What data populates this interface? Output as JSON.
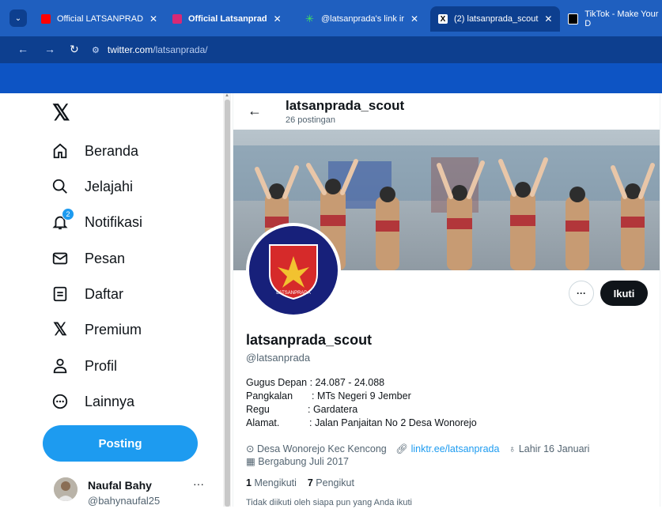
{
  "browser": {
    "tabs": [
      {
        "title": "Official LATSANPRAD",
        "icon": "youtube-icon",
        "color": "#ff0000"
      },
      {
        "title": "Official Latsanprad",
        "icon": "instagram-icon",
        "color": "#d62976"
      },
      {
        "title": "@latsanprada's link ir",
        "icon": "linktree-icon",
        "color": "#43e55e"
      },
      {
        "title": "(2) latsanprada_scout",
        "icon": "x-icon",
        "color": "#000000"
      },
      {
        "title": "TikTok - Make Your D",
        "icon": "tiktok-icon",
        "color": "#000000"
      }
    ],
    "url_domain": "twitter.com",
    "url_path": "/latsanprada/",
    "accent_color": "#0d3f8f"
  },
  "sidebar": {
    "items": [
      {
        "label": "Beranda",
        "icon": "home-icon"
      },
      {
        "label": "Jelajahi",
        "icon": "search-icon"
      },
      {
        "label": "Notifikasi",
        "icon": "bell-icon",
        "badge": "2"
      },
      {
        "label": "Pesan",
        "icon": "mail-icon"
      },
      {
        "label": "Daftar",
        "icon": "list-icon"
      },
      {
        "label": "Premium",
        "icon": "x-logo-icon"
      },
      {
        "label": "Profil",
        "icon": "person-icon"
      },
      {
        "label": "Lainnya",
        "icon": "more-circle-icon"
      }
    ],
    "post_button": "Posting",
    "account": {
      "name": "Naufal Bahy",
      "handle": "@bahynaufal25",
      "more": "···"
    }
  },
  "header": {
    "name": "latsanprada_scout",
    "posts": "26 postingan"
  },
  "profile": {
    "logo_text": "LATSANPRADA",
    "more_button": "···",
    "follow_button": "Ikuti",
    "name": "latsanprada_scout",
    "handle": "@latsanprada",
    "bio": {
      "line1": "Gugus Depan : 24.087 - 24.088",
      "pangkalan_label": "Pangkalan",
      "pangkalan_value": ": MTs Negeri 9 Jember",
      "regu_label": "Regu",
      "regu_value": ": Gardatera",
      "alamat_label": "Alamat.",
      "alamat_value": ": Jalan Panjaitan No 2 Desa Wonorejo"
    },
    "location": "Desa Wonorejo Kec Kencong",
    "link": "linktr.ee/latsanprada",
    "birthday": "Lahir 16 Januari",
    "joined": "Bergabung Juli 2017",
    "following_count": "1",
    "following_label": "Mengikuti",
    "followers_count": "7",
    "followers_label": "Pengikut",
    "followed_by": "Tidak diikuti oleh siapa pun yang Anda ikuti"
  },
  "colors": {
    "twitter_blue": "#1d9bf0",
    "text": "#0f1419",
    "muted": "#536471"
  }
}
